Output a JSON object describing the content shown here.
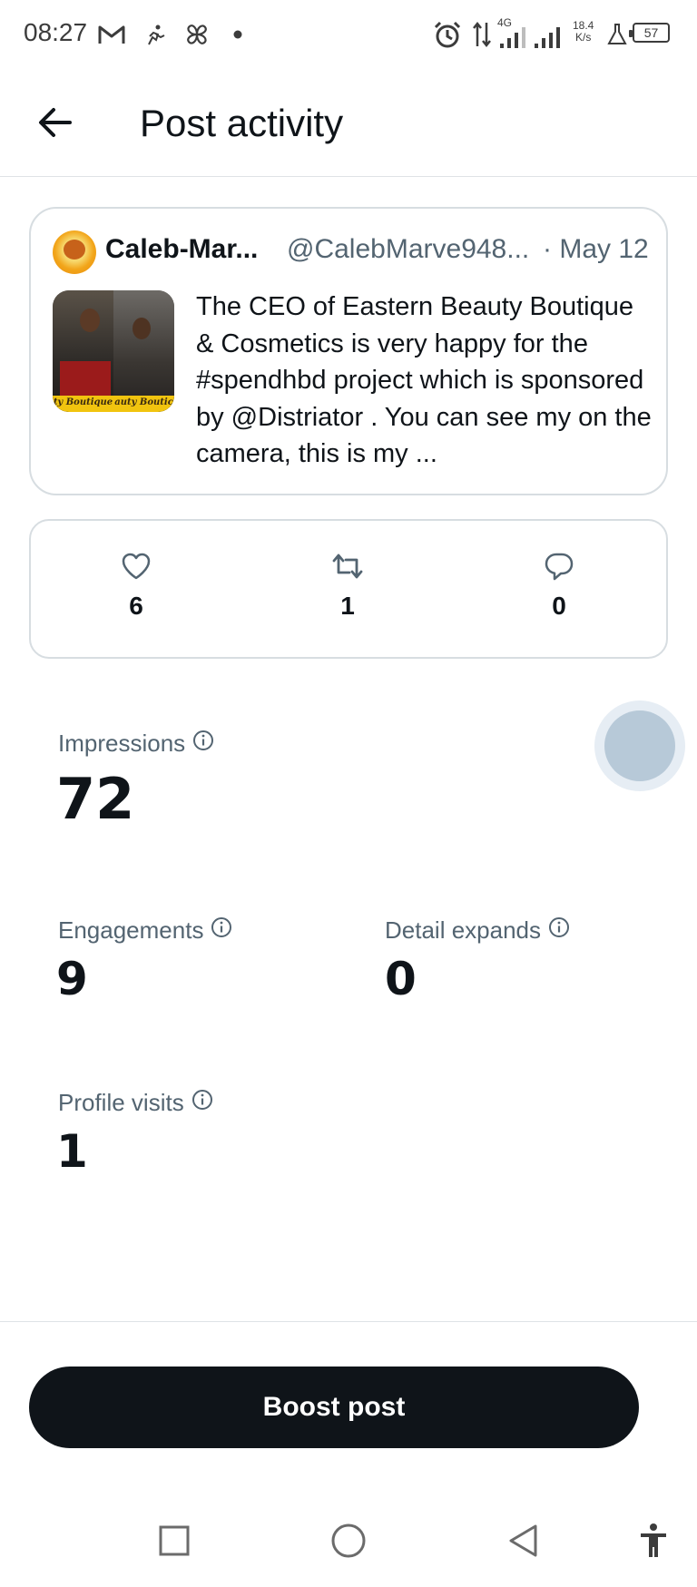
{
  "status_bar": {
    "time": "08:27",
    "network_type": "4G",
    "speed_value": "18.4",
    "speed_unit": "K/s",
    "battery": "57",
    "icons": [
      "gmail-icon",
      "activity-icon",
      "pinwheel-icon",
      "dot-icon",
      "alarm-icon",
      "data-arrows-icon",
      "signal-icon",
      "signal-icon",
      "lab-icon",
      "battery-icon"
    ]
  },
  "header": {
    "title": "Post activity",
    "back_icon": "back-arrow-icon"
  },
  "post": {
    "author": "Caleb-Mar...",
    "handle": "@CalebMarve948...",
    "date": "· May 12",
    "text": "The CEO of Eastern Beauty Boutique & Cosmetics is very happy for the #spendhbd project which is sponsored by @Distriator . You can see my on the camera, this is my ...",
    "media_caption_left": "ty Boutique",
    "media_caption_right": "auty Boutic"
  },
  "metrics": [
    {
      "icon": "heart-icon",
      "value": "6"
    },
    {
      "icon": "repost-icon",
      "value": "1"
    },
    {
      "icon": "reply-icon",
      "value": "0"
    }
  ],
  "stats": {
    "impressions": {
      "label": "Impressions",
      "value": "72"
    },
    "engagements": {
      "label": "Engagements",
      "value": "9"
    },
    "detail_expands": {
      "label": "Detail expands",
      "value": "0"
    },
    "profile_visits": {
      "label": "Profile visits",
      "value": "1"
    }
  },
  "boost_button": "Boost post",
  "nav_bar": [
    "recents-icon",
    "home-icon",
    "back-icon",
    "accessibility-icon"
  ],
  "colors": {
    "text_primary": "#0f1419",
    "text_secondary": "#536471",
    "border": "#d7dde1",
    "button_bg": "#0f1419",
    "fab": "#b7c9d8"
  }
}
